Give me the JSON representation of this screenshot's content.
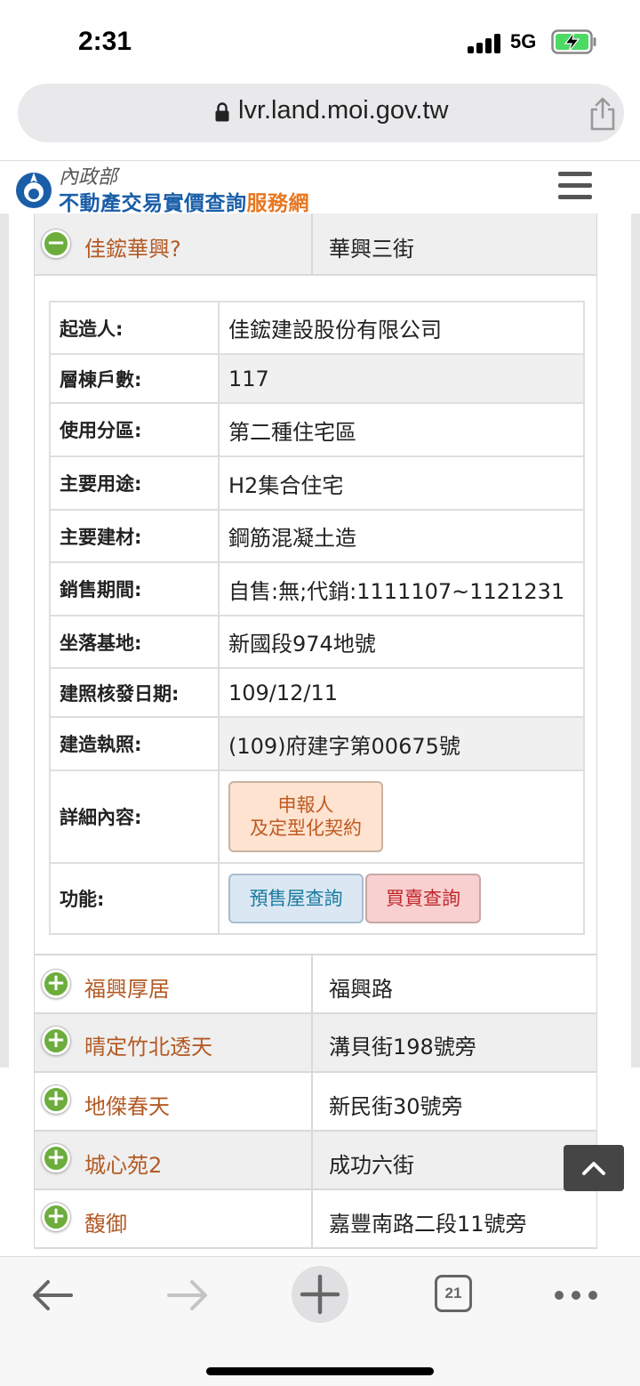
{
  "status_bar": {
    "time": "2:31",
    "network": "5G"
  },
  "browser": {
    "url": "lvr.land.moi.gov.tw"
  },
  "header": {
    "ministry": "內政部",
    "title_main": "不動產交易實價查詢",
    "title_accent": "服務網"
  },
  "expanded_project": {
    "name": "佳鋐華興?",
    "address": "華興三街",
    "details": [
      {
        "label": "起造人:",
        "value": "佳鋐建設股份有限公司"
      },
      {
        "label": "層棟戶數:",
        "value": "117"
      },
      {
        "label": "使用分區:",
        "value": "第二種住宅區"
      },
      {
        "label": "主要用途:",
        "value": "H2集合住宅"
      },
      {
        "label": "主要建材:",
        "value": "鋼筋混凝土造"
      },
      {
        "label": "銷售期間:",
        "value": "自售:無;代銷:1111107~1121231"
      },
      {
        "label": "坐落基地:",
        "value": "新國段974地號"
      },
      {
        "label": "建照核發日期:",
        "value": "109/12/11"
      },
      {
        "label": "建造執照:",
        "value": "(109)府建字第00675號"
      }
    ],
    "detail_label": "詳細內容:",
    "contract_button_line1": "申報人",
    "contract_button_line2": "及定型化契約",
    "function_label": "功能:",
    "presale_button": "預售屋查詢",
    "trade_button": "買賣查詢"
  },
  "projects": [
    {
      "name": "福興厚居",
      "address": "福興路"
    },
    {
      "name": "晴定竹北透天",
      "address": "溝貝街198號旁"
    },
    {
      "name": "地傑春天",
      "address": "新民街30號旁"
    },
    {
      "name": "城心苑2",
      "address": "成功六街"
    },
    {
      "name": "馥御",
      "address": "嘉豐南路二段11號旁"
    }
  ],
  "toolbar": {
    "tabs_count": "21"
  },
  "colors": {
    "brand_blue": "#1a5ea8",
    "accent_orange": "#e87722",
    "toggle_green": "#6cad3c",
    "project_name": "#b35a24"
  }
}
